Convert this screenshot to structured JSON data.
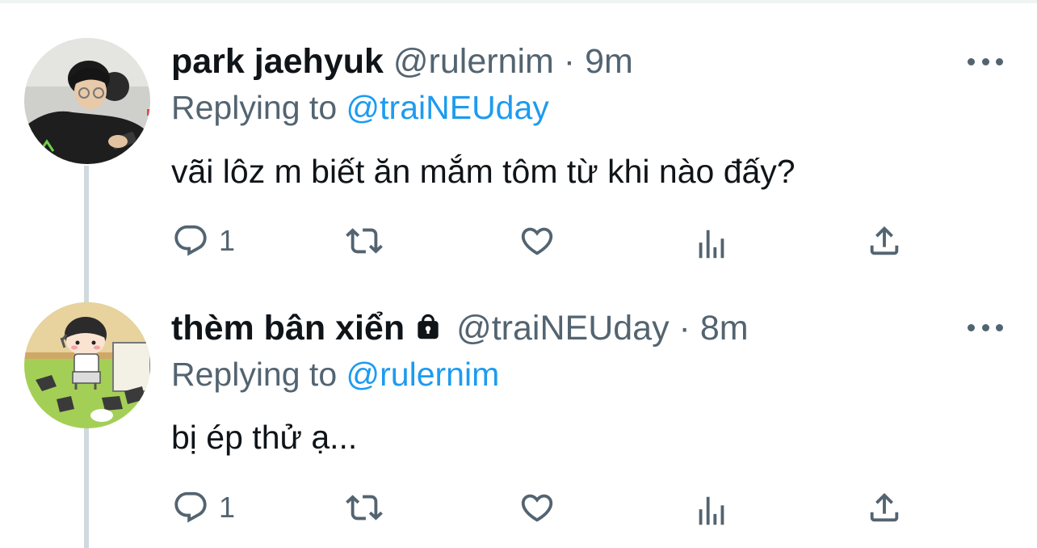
{
  "tweets": [
    {
      "name": "park jaehyuk",
      "handle": "@rulernim",
      "sep": "·",
      "time": "9m",
      "replying_prefix": "Replying to",
      "replying_to": "@traiNEUday",
      "text": "vãi lôz m biết ăn mắm tôm từ khi nào đấy?",
      "reply_count": "1",
      "avatar_icon": "photo-avatar"
    },
    {
      "name": "thèm bân xiển",
      "handle": "@traiNEUday",
      "sep": "·",
      "time": "8m",
      "replying_prefix": "Replying to",
      "replying_to": "@rulernim",
      "text": "bị ép thử ạ...",
      "reply_count": "1",
      "protected_icon": "lock-icon",
      "avatar_icon": "cartoon-avatar"
    }
  ],
  "colors": {
    "text": "#0f1419",
    "muted": "#536471",
    "link": "#1d9bf0",
    "thread_line": "#cfd9de"
  }
}
